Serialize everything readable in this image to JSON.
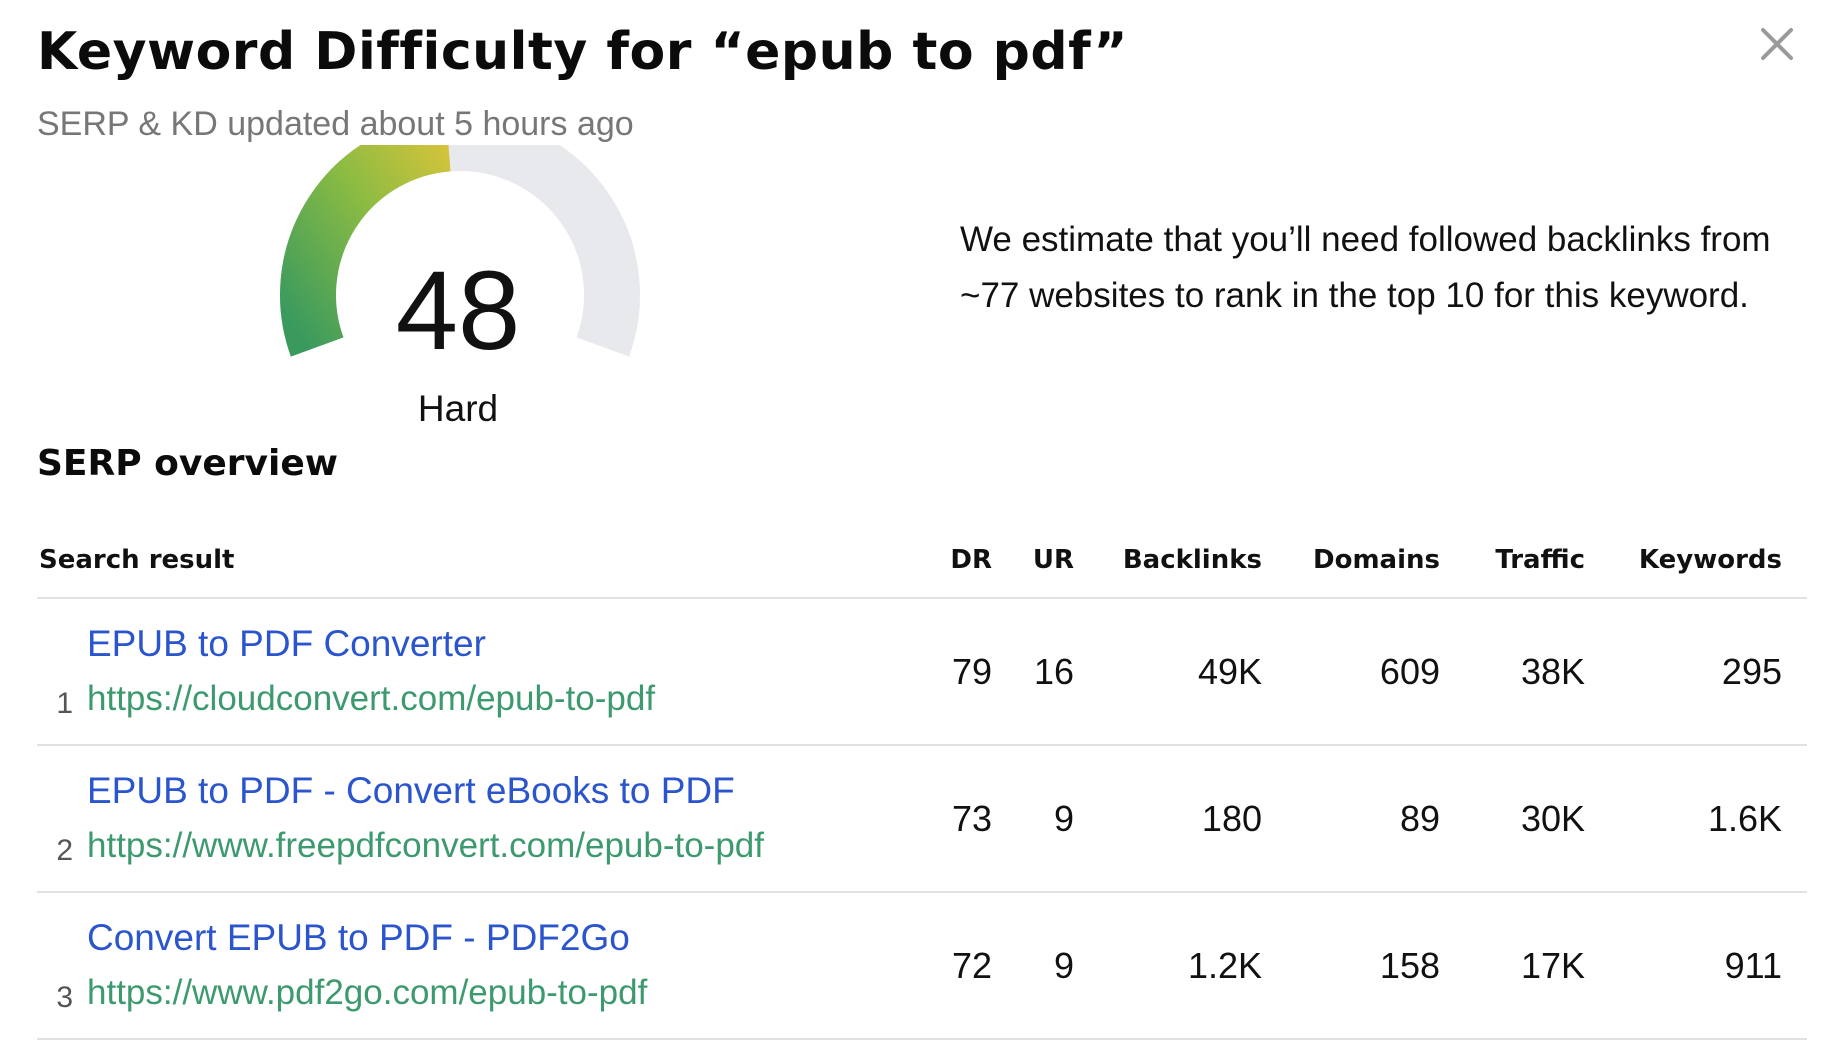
{
  "header": {
    "title": "Keyword Difficulty for “epub to pdf”",
    "subtitle": "SERP & KD updated about 5 hours ago",
    "close_icon": "close-icon"
  },
  "difficulty": {
    "score": "48",
    "score_value": 48,
    "score_max": 100,
    "label": "Hard",
    "gauge_colors": [
      "#3a9a5e",
      "#8bbb43",
      "#d6c43a"
    ],
    "track_color": "#e8e9ec"
  },
  "estimate": {
    "text": "We estimate that you’ll need followed backlinks from ~77 websites to rank in the top 10 for this keyword."
  },
  "serp": {
    "section_title": "SERP overview",
    "columns": {
      "result": "Search result",
      "dr": "DR",
      "ur": "UR",
      "backlinks": "Backlinks",
      "domains": "Domains",
      "traffic": "Traffic",
      "keywords": "Keywords"
    },
    "rows": [
      {
        "rank": "1",
        "title": "EPUB to PDF Converter",
        "url": "https://cloudconvert.com/epub-to-pdf",
        "dr": "79",
        "ur": "16",
        "backlinks": "49K",
        "domains": "609",
        "traffic": "38K",
        "keywords": "295"
      },
      {
        "rank": "2",
        "title": "EPUB to PDF - Convert eBooks to PDF",
        "url": "https://www.freepdfconvert.com/epub-to-pdf",
        "dr": "73",
        "ur": "9",
        "backlinks": "180",
        "domains": "89",
        "traffic": "30K",
        "keywords": "1.6K"
      },
      {
        "rank": "3",
        "title": "Convert EPUB to PDF - PDF2Go",
        "url": "https://www.pdf2go.com/epub-to-pdf",
        "dr": "72",
        "ur": "9",
        "backlinks": "1.2K",
        "domains": "158",
        "traffic": "17K",
        "keywords": "911"
      }
    ]
  }
}
